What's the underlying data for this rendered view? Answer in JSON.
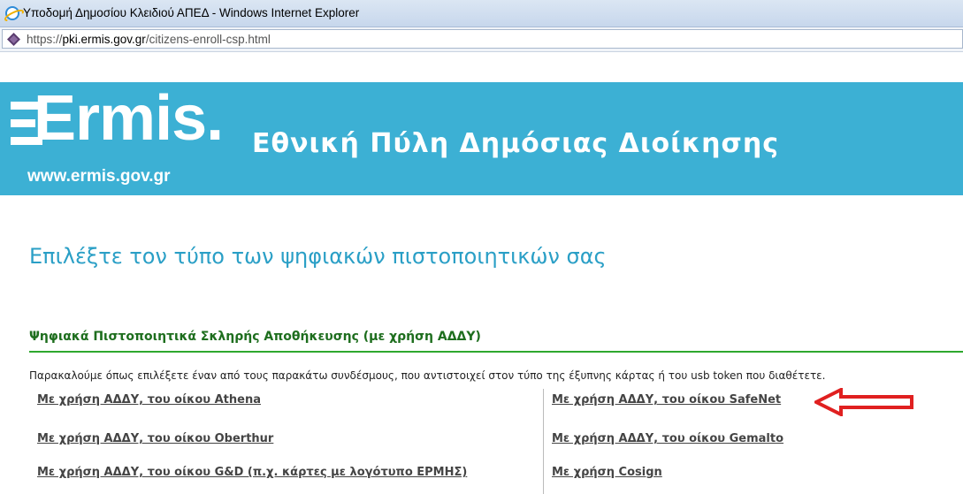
{
  "window": {
    "title": "Υποδομή Δημοσίου Κλειδιού ΑΠΕΔ - Windows Internet Explorer"
  },
  "address_bar": {
    "scheme": "https://",
    "domain": "pki.ermis.gov.gr",
    "path": "/citizens-enroll-csp.html"
  },
  "banner": {
    "logo_text": "Ermis.",
    "logo_url": "www.ermis.gov.gr",
    "portal_title": "Εθνική Πύλη Δημόσιας Διοίκησης",
    "background_color": "#3cb0d4"
  },
  "page": {
    "heading": "Επιλέξτε τον τύπο των ψηφιακών πιστοποιητικών σας",
    "section_heading": "Ψηφιακά Πιστοποιητικά Σκληρής Αποθήκευσης (με χρήση ΑΔΔΥ)",
    "instructions": "Παρακαλούμε όπως επιλέξετε έναν από τους παρακάτω συνδέσμους, που αντιστοιχεί στον τύπο της έξυπνης κάρτας ή του usb token που διαθέτετε."
  },
  "links": {
    "left": [
      "Με χρήση ΑΔΔΥ, του οίκου Athena",
      "Με χρήση ΑΔΔΥ, του οίκου Oberthur",
      "Με χρήση ΑΔΔΥ, του οίκου G&D (π.χ. κάρτες με λογότυπο ΕΡΜΗΣ)"
    ],
    "right": [
      "Με χρήση ΑΔΔΥ, του οίκου SafeNet",
      "Με χρήση ΑΔΔΥ, του οίκου Gemalto",
      "Με χρήση Cosign"
    ]
  },
  "annotation": {
    "icon": "red-arrow-icon",
    "color": "#e02020"
  }
}
